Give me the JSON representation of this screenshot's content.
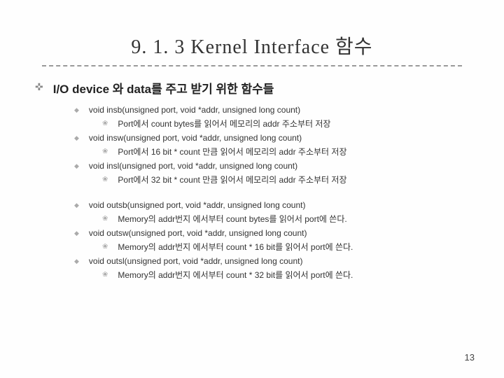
{
  "title": "9. 1. 3 Kernel Interface 함수",
  "heading": "I/O device 와 data를 주고 받기 위한 함수들",
  "group1": [
    {
      "fn": "void insb(unsigned port, void *addr, unsigned long count)",
      "desc": "Port에서 count bytes를 읽어서 메모리의 addr 주소부터 저장"
    },
    {
      "fn": "void insw(unsigned port, void *addr, unsigned long count)",
      "desc": "Port에서 16 bit * count 만큼 읽어서 메모리의 addr 주소부터 저장"
    },
    {
      "fn": "void insl(unsigned port, void *addr, unsigned long count)",
      "desc": "Port에서 32 bit * count 만큼 읽어서 메모리의 addr 주소부터 저장"
    }
  ],
  "group2": [
    {
      "fn": "void outsb(unsigned port, void *addr, unsigned long count)",
      "desc": "Memory의 addr번지 에서부터 count bytes를 읽어서 port에 쓴다."
    },
    {
      "fn": "void outsw(unsigned port, void *addr, unsigned long count)",
      "desc": "Memory의 addr번지 에서부터 count * 16 bit를 읽어서 port에 쓴다."
    },
    {
      "fn": "void outsl(unsigned port, void *addr, unsigned long count)",
      "desc": "Memory의 addr번지 에서부터 count * 32 bit를 읽어서 port에 쓴다."
    }
  ],
  "pageNumber": "13",
  "bullets": {
    "plus": "✜",
    "diamond": "◆",
    "flower": "❀"
  }
}
